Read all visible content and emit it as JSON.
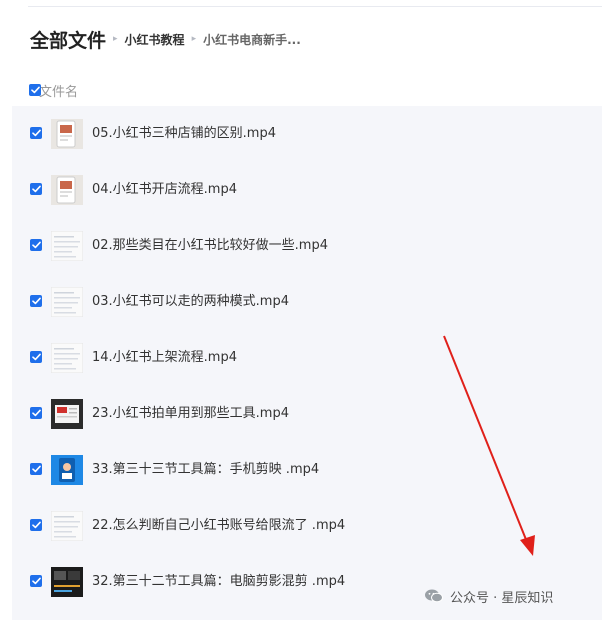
{
  "header": {
    "title": "全部文件",
    "breadcrumbs": [
      "小红书教程",
      "小红书电商新手..."
    ]
  },
  "column_header": {
    "label": "文件名",
    "checked": true
  },
  "files": [
    {
      "name": "05.小红书三种店铺的区别.mp4",
      "checked": true,
      "thumb": "phone-screenshot"
    },
    {
      "name": "04.小红书开店流程.mp4",
      "checked": true,
      "thumb": "phone-screenshot"
    },
    {
      "name": "02.那些类目在小红书比较好做一些.mp4",
      "checked": true,
      "thumb": "document-page"
    },
    {
      "name": "03.小红书可以走的两种模式.mp4",
      "checked": true,
      "thumb": "document-page"
    },
    {
      "name": "14.小红书上架流程.mp4",
      "checked": true,
      "thumb": "document-page"
    },
    {
      "name": "23.小红书拍单用到那些工具.mp4",
      "checked": true,
      "thumb": "red-slide"
    },
    {
      "name": "33.第三十三节工具篇：手机剪映 .mp4",
      "checked": true,
      "thumb": "blue-app"
    },
    {
      "name": "22.怎么判断自己小红书账号给限流了 .mp4",
      "checked": true,
      "thumb": "document-page"
    },
    {
      "name": "32.第三十二节工具篇：电脑剪影混剪 .mp4",
      "checked": true,
      "thumb": "dark-editor"
    }
  ],
  "watermark": {
    "text": "公众号 · 星辰知识",
    "icon": "wechat-icon"
  },
  "colors": {
    "accent": "#1f6feb",
    "arrow": "#e0201a",
    "list_bg": "#f5f6fa"
  }
}
